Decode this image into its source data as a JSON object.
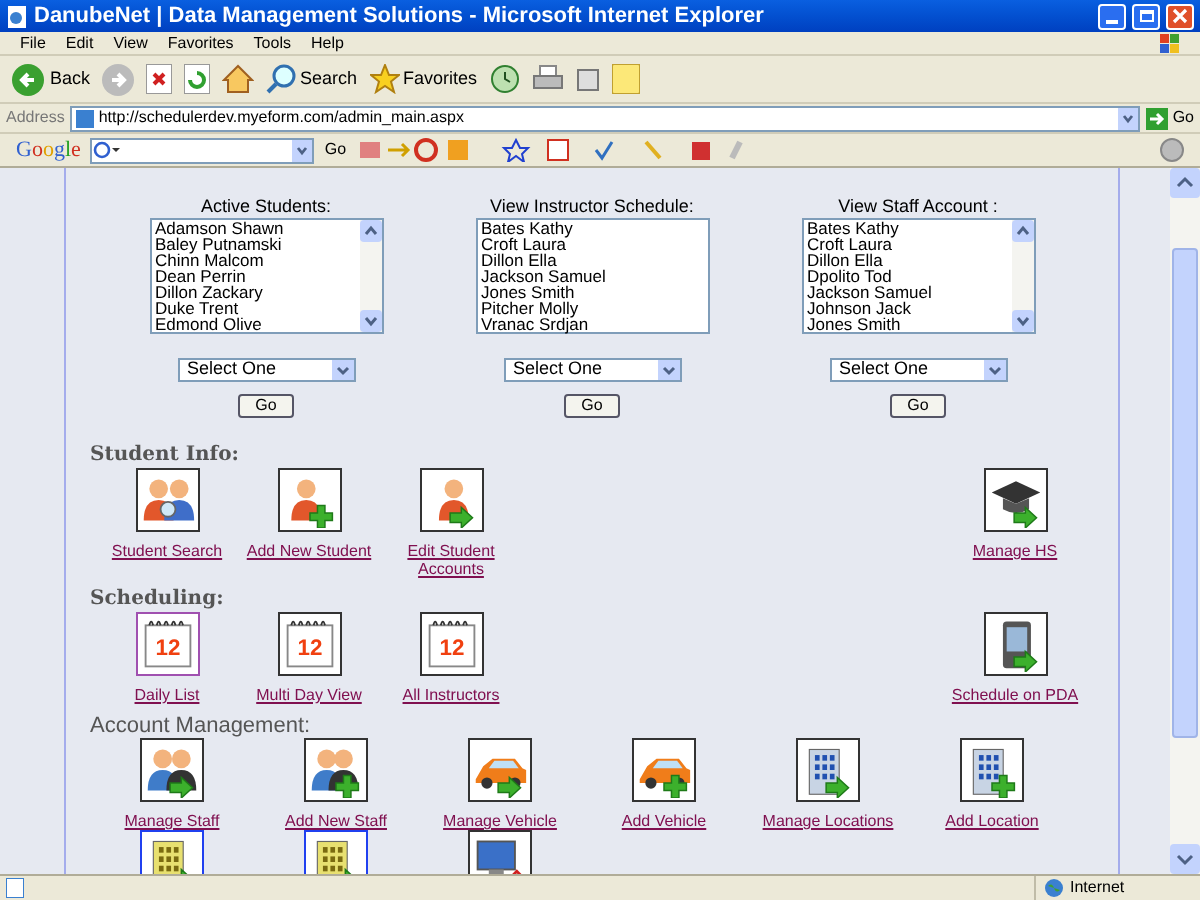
{
  "window": {
    "title": "DanubeNet | Data Management Solutions - Microsoft Internet Explorer"
  },
  "menu": [
    "File",
    "Edit",
    "View",
    "Favorites",
    "Tools",
    "Help"
  ],
  "toolbar": {
    "back": "Back",
    "search": "Search",
    "favorites": "Favorites"
  },
  "address": {
    "label": "Address",
    "url": "http://schedulerdev.myeform.com/admin_main.aspx",
    "go": "Go"
  },
  "google_bar": {
    "logo": "Google",
    "go": "Go"
  },
  "selectors": [
    {
      "title": "Active Students:",
      "items": [
        "Adamson Shawn",
        "Baley Putnamski",
        "Chinn Malcom",
        "Dean Perrin",
        "Dillon Zackary",
        "Duke Trent",
        "Edmond Olive"
      ],
      "scrollbar": true,
      "select": "Select One",
      "button": "Go"
    },
    {
      "title": "View Instructor Schedule:",
      "items": [
        "Bates Kathy",
        "Croft Laura",
        "Dillon Ella",
        "Jackson Samuel",
        "Jones Smith",
        "Pitcher Molly",
        "Vranac Srdjan"
      ],
      "scrollbar": false,
      "select": "Select One",
      "button": "Go"
    },
    {
      "title": "View Staff Account :",
      "items": [
        "Bates Kathy",
        "Croft Laura",
        "Dillon Ella",
        "Dpolito Tod",
        "Jackson Samuel",
        "Johnson Jack",
        "Jones Smith"
      ],
      "scrollbar": true,
      "select": "Select One",
      "button": "Go"
    }
  ],
  "sections": [
    {
      "title": "Student Info:",
      "links": [
        {
          "label": "Student Search",
          "kind": "people-search",
          "highlighted": false
        },
        {
          "label": "Add New Student",
          "kind": "person-add",
          "highlighted": false
        },
        {
          "label": "Edit Student Accounts",
          "kind": "person-arrow",
          "highlighted": false
        }
      ],
      "right_links": [
        {
          "label": "Manage HS",
          "kind": "graduation",
          "highlighted": false
        }
      ]
    },
    {
      "title": "Scheduling:",
      "links": [
        {
          "label": "Daily List",
          "kind": "calendar",
          "icon_text": "12",
          "highlighted": true
        },
        {
          "label": "Multi Day View",
          "kind": "calendar",
          "icon_text": "12",
          "highlighted": false
        },
        {
          "label": "All Instructors",
          "kind": "calendar",
          "icon_text": "12",
          "highlighted": false
        }
      ],
      "right_links": [
        {
          "label": "Schedule on PDA",
          "kind": "pda",
          "highlighted": false
        }
      ]
    },
    {
      "title": "Account Management:",
      "links": [
        {
          "label": "Manage Staff",
          "kind": "staff-arrow",
          "highlighted": false
        },
        {
          "label": "Add New Staff",
          "kind": "staff-add",
          "highlighted": false
        },
        {
          "label": "Manage Vehicle",
          "kind": "car-arrow",
          "highlighted": false
        },
        {
          "label": "Add Vehicle",
          "kind": "car-add",
          "highlighted": false
        },
        {
          "label": "Manage Locations",
          "kind": "building-arrow",
          "highlighted": false
        },
        {
          "label": "Add Location",
          "kind": "building-add",
          "highlighted": false
        },
        {
          "kind": "yellow-building-arrow",
          "highlighted": true
        },
        {
          "kind": "yellow-building-arrow",
          "highlighted": true
        },
        {
          "kind": "computer",
          "highlighted": false
        }
      ]
    }
  ],
  "status_bar": {
    "zone": "Internet"
  }
}
